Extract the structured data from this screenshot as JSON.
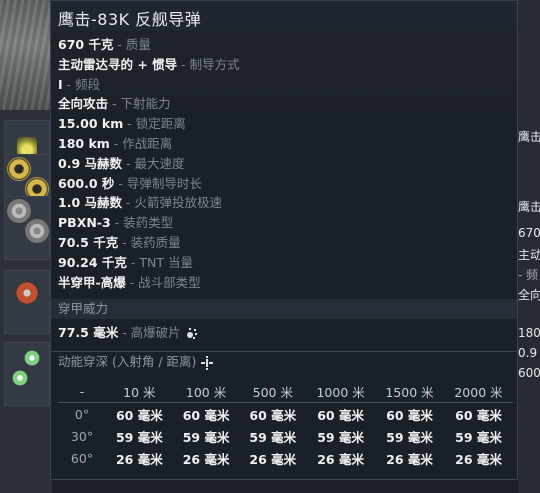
{
  "weapon": {
    "name_a": "鹰击",
    "name_b": "-83K 反舰导弹"
  },
  "stats": [
    {
      "value": "670 千克",
      "key": "质量"
    },
    {
      "value": "主动雷达寻的 + 惯导",
      "key": "制导方式"
    },
    {
      "value": "I",
      "key": "频段"
    },
    {
      "value": "全向攻击",
      "key": "下射能力"
    },
    {
      "value": "15.00 km",
      "key": "锁定距离"
    },
    {
      "value": "180 km",
      "key": "作战距离"
    },
    {
      "value": "0.9 马赫数",
      "key": "最大速度"
    },
    {
      "value": "600.0 秒",
      "key": "导弹制导时长"
    },
    {
      "value": "1.0 马赫数",
      "key": "火箭弹投放极速"
    },
    {
      "value": "PBXN-3",
      "key": "装药类型"
    },
    {
      "value": "70.5 千克",
      "key": "装药质量"
    },
    {
      "value": "90.24 千克",
      "key": "TNT 当量"
    },
    {
      "value": "半穿甲-高爆",
      "key": "战斗部类型"
    }
  ],
  "penetration_section": "穿甲威力",
  "he_fragment": {
    "value": "77.5 毫米",
    "key": "高爆破片"
  },
  "kinetic_header": "动能穿深 (入射角 / 距离)",
  "table": {
    "corner": "-",
    "columns": [
      "10 米",
      "100 米",
      "500 米",
      "1000 米",
      "1500 米",
      "2000 米"
    ],
    "rows": [
      {
        "angle": "0°",
        "cells": [
          "60 毫米",
          "60 毫米",
          "60 毫米",
          "60 毫米",
          "60 毫米",
          "60 毫米"
        ]
      },
      {
        "angle": "30°",
        "cells": [
          "59 毫米",
          "59 毫米",
          "59 毫米",
          "59 毫米",
          "59 毫米",
          "59 毫米"
        ]
      },
      {
        "angle": "60°",
        "cells": [
          "26 毫米",
          "26 毫米",
          "26 毫米",
          "26 毫米",
          "26 毫米",
          "26 毫米"
        ]
      }
    ]
  },
  "background_right": [
    "鹰击",
    "鹰击",
    "670",
    "主动",
    "- 频",
    "全向",
    "180",
    "0.9",
    "600"
  ],
  "icons": {
    "left": [
      "missile-yellow-icon",
      "wheel-gold-icon",
      "cluster-gray-icon",
      "target-orange-icon",
      "starburst-green-icon"
    ],
    "fragment": "fragment-icon",
    "angle": "angle-icon"
  },
  "colors": {
    "value": "#f2f2f2",
    "key": "#7d8590",
    "panel": "#1b2028"
  }
}
